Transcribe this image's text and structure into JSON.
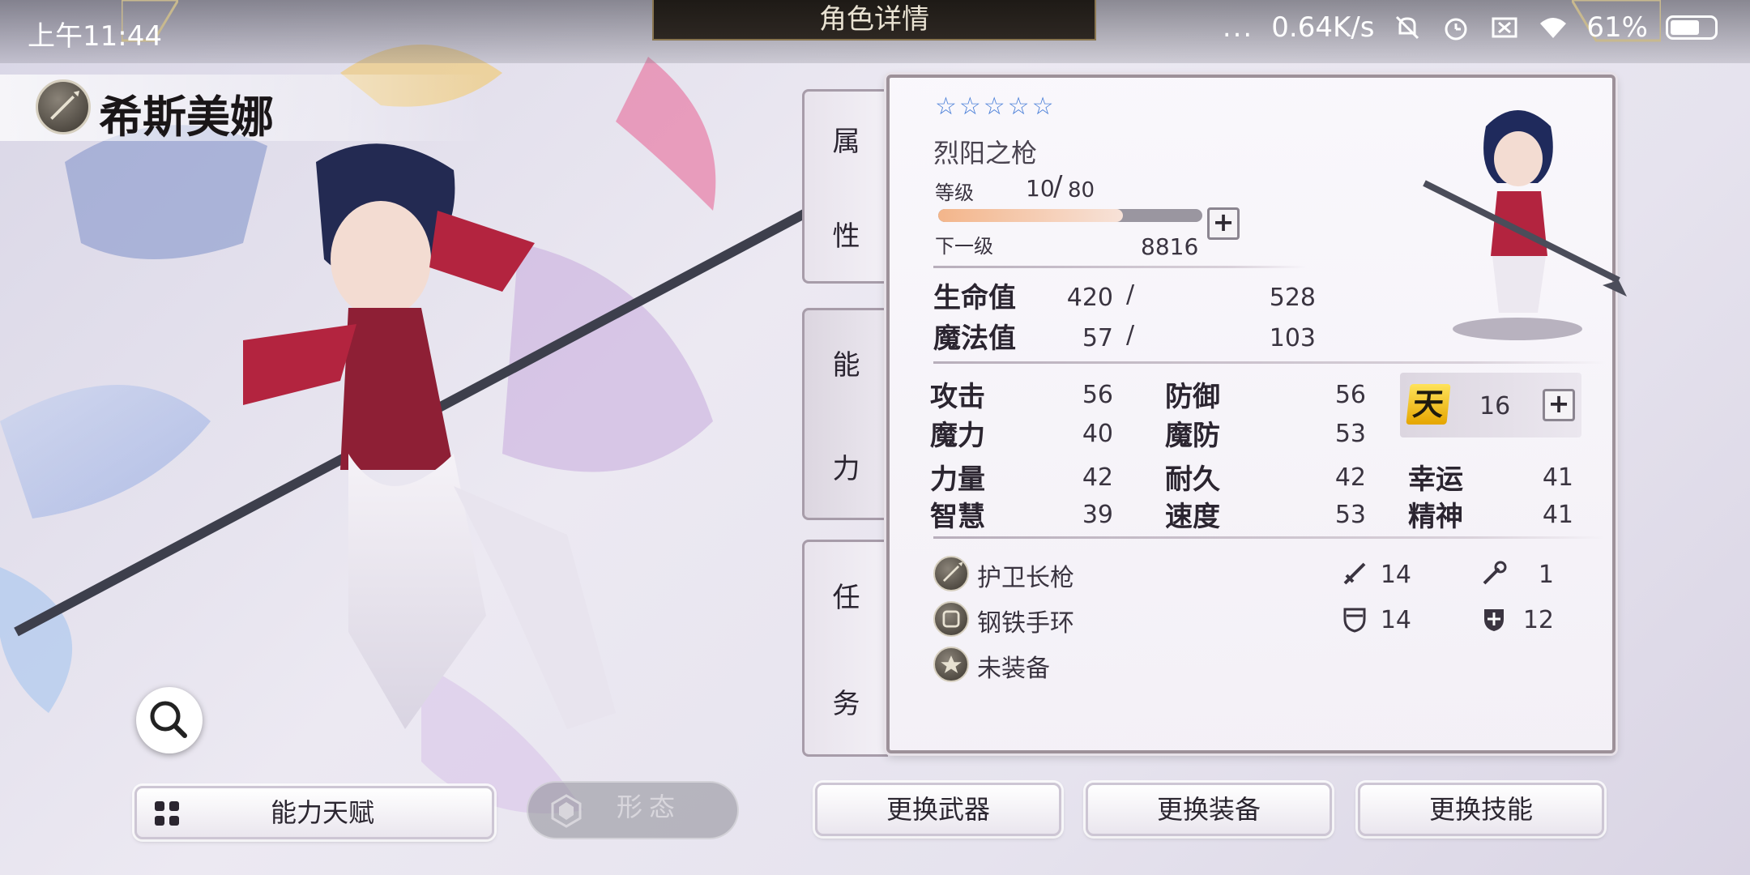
{
  "status_bar": {
    "time": "上午11:44",
    "more": "...",
    "net_speed": "0.64K/s",
    "battery": "61%",
    "icons": [
      "mute-icon",
      "alarm-icon",
      "sim-off-icon",
      "wifi-icon",
      "battery-icon"
    ]
  },
  "header": {
    "title": "角色详情"
  },
  "character": {
    "name": "希斯美娜",
    "class_icon": "spear-icon"
  },
  "tabs": [
    {
      "label_1": "属",
      "label_2": "性"
    },
    {
      "label_1": "能",
      "label_2": "力"
    },
    {
      "label_1": "任",
      "label_2": "务"
    }
  ],
  "panel": {
    "stars": "☆☆☆☆☆",
    "weapon_title": "烈阳之枪",
    "level": {
      "label": "等级",
      "current": "10",
      "slash": "/",
      "max": "80",
      "progress": 0.7
    },
    "next": {
      "label": "下一级",
      "value": "8816"
    },
    "hp": {
      "label": "生命值",
      "current": "420",
      "slash": "/",
      "max": "528"
    },
    "mp": {
      "label": "魔法值",
      "current": "57",
      "slash": "/",
      "max": "103"
    },
    "stats": {
      "attack": {
        "label": "攻击",
        "value": "56"
      },
      "magic": {
        "label": "魔力",
        "value": "40"
      },
      "strength": {
        "label": "力量",
        "value": "42"
      },
      "wisdom": {
        "label": "智慧",
        "value": "39"
      },
      "defense": {
        "label": "防御",
        "value": "56"
      },
      "mdef": {
        "label": "魔防",
        "value": "53"
      },
      "endurance": {
        "label": "耐久",
        "value": "42"
      },
      "speed": {
        "label": "速度",
        "value": "53"
      },
      "luck": {
        "label": "幸运",
        "value": "41"
      },
      "spirit": {
        "label": "精神",
        "value": "41"
      }
    },
    "heaven": {
      "icon_text": "天",
      "value": "16"
    },
    "equipment": [
      {
        "name": "护卫长枪",
        "val1": "14",
        "val2": "1",
        "icon": "spear-icon"
      },
      {
        "name": "钢铁手环",
        "val1": "14",
        "val2": "12",
        "icon": "bracelet-icon"
      },
      {
        "name": "未装备",
        "icon": "empty-slot-icon"
      }
    ],
    "plus": "+"
  },
  "buttons": {
    "talent": "能力天赋",
    "form": "形态",
    "change_weapon": "更换武器",
    "change_equip": "更换装备",
    "change_skill": "更换技能"
  },
  "colors": {
    "accent_star": "#4a7fd8",
    "heaven_gold": "#f2c31a",
    "panel_border": "#9d9199",
    "title_plate": "#1e1a16"
  }
}
